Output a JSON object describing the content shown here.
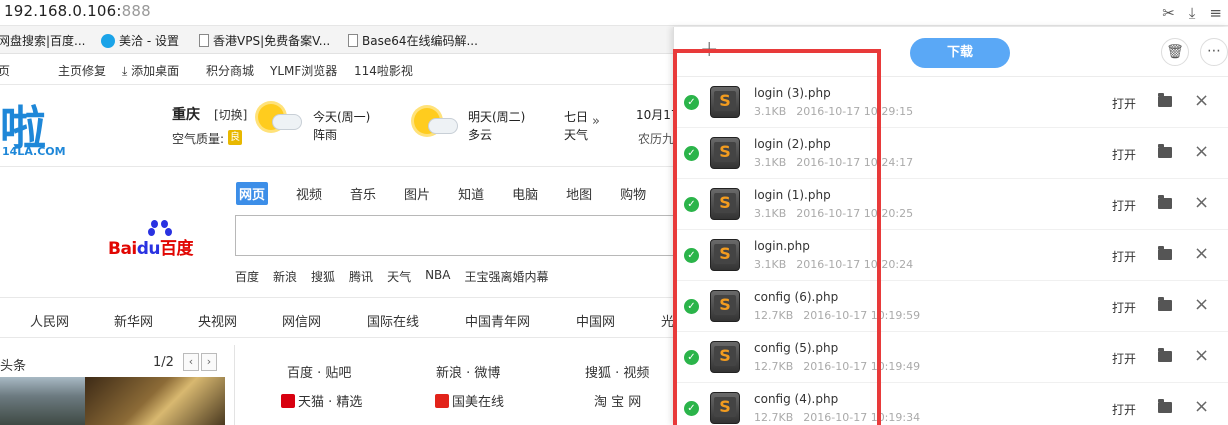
{
  "browser": {
    "address_host": "192.168.0.106:",
    "address_port": "888",
    "bookmarks": [
      {
        "label": "网盘搜索|百度..."
      },
      {
        "label": "美洽 - 设置"
      },
      {
        "label": "香港VPS|免费备案V..."
      },
      {
        "label": "Base64在线编码解..."
      }
    ],
    "icons": [
      "scissors-icon",
      "download-icon",
      "menu-icon"
    ]
  },
  "page": {
    "nav_items": [
      "页",
      "主页修复",
      "添加桌面",
      "积分商城",
      "YLMF浏览器",
      "114啦影视"
    ],
    "logo_text": "啦",
    "logo_sub": "14LA.COM",
    "weather": {
      "city": "重庆",
      "switch": "[切换]",
      "aqi_label": "空气质量:",
      "aqi_value": "良",
      "today_label": "今天(周一)",
      "today_cond": "阵雨",
      "tomorrow_label": "明天(周二)",
      "tomorrow_cond": "多云",
      "seven_label": "七日",
      "seven_sub": "天气",
      "date_line1": "10月17",
      "date_line2": "农历九"
    },
    "search_tabs": [
      "网页",
      "视频",
      "音乐",
      "图片",
      "知道",
      "电脑",
      "地图",
      "购物"
    ],
    "baidu": {
      "left": "Bai",
      "mid": "du",
      "right": "百度"
    },
    "hot_links": [
      "百度",
      "新浪",
      "搜狐",
      "腾讯",
      "天气",
      "NBA",
      "王宝强离婚内幕"
    ],
    "site_links": [
      "人民网",
      "新华网",
      "央视网",
      "网信网",
      "国际在线",
      "中国青年网",
      "中国网",
      "光"
    ],
    "headline_label": "头条",
    "pager": "1/2",
    "nav_grid": [
      {
        "label": "百度 · 贴吧"
      },
      {
        "label": "新浪 · 微博"
      },
      {
        "label": "搜狐 · 视频"
      },
      {
        "label": "天猫 · 精选"
      },
      {
        "label": "国美在线"
      },
      {
        "label": "淘 宝 网"
      }
    ]
  },
  "downloads": {
    "download_button": "下载",
    "open_label": "打开",
    "items": [
      {
        "name": "login (3).php",
        "size": "3.1KB",
        "time": "2016-10-17 10:29:15"
      },
      {
        "name": "login (2).php",
        "size": "3.1KB",
        "time": "2016-10-17 10:24:17"
      },
      {
        "name": "login (1).php",
        "size": "3.1KB",
        "time": "2016-10-17 10:20:25"
      },
      {
        "name": "login.php",
        "size": "3.1KB",
        "time": "2016-10-17 10:20:24"
      },
      {
        "name": "config (6).php",
        "size": "12.7KB",
        "time": "2016-10-17 10:19:59"
      },
      {
        "name": "config (5).php",
        "size": "12.7KB",
        "time": "2016-10-17 10:19:49"
      },
      {
        "name": "config (4).php",
        "size": "12.7KB",
        "time": "2016-10-17 10:19:34"
      }
    ]
  },
  "colors": {
    "accent": "#5aa8f6",
    "highlight": "#e83a3a",
    "success": "#2bb44a"
  }
}
